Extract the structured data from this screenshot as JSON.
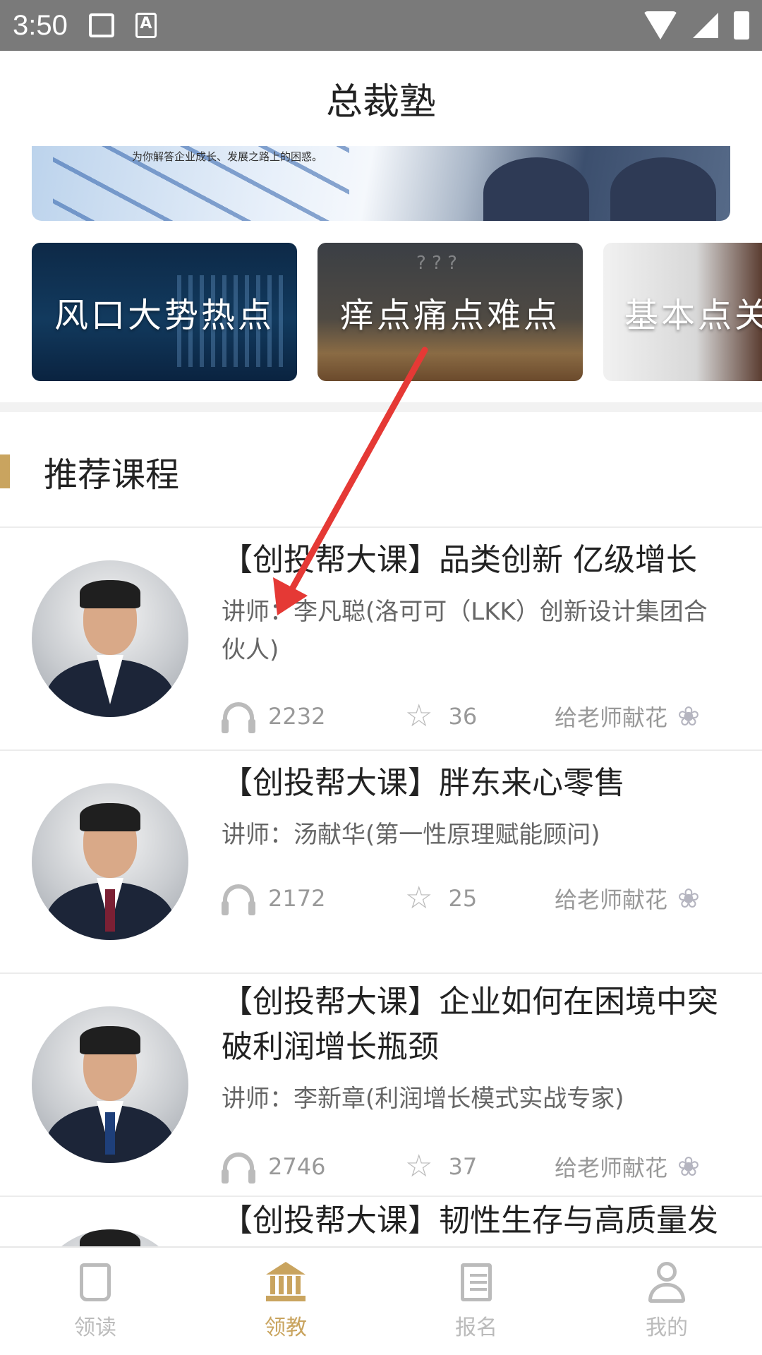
{
  "status_bar": {
    "time": "3:50",
    "icon_a": "A"
  },
  "header": {
    "title": "总裁塾"
  },
  "banner": {
    "text": "为你解答企业成长、发展之路上的困惑。"
  },
  "categories": [
    {
      "label": "风口大势热点"
    },
    {
      "label": "痒点痛点难点"
    },
    {
      "label": "基本点关"
    }
  ],
  "section": {
    "title": "推荐课程"
  },
  "courses": [
    {
      "title": "【创投帮大课】品类创新 亿级增长",
      "teacher": "讲师：李凡聪(洛可可（LKK）创新设计集团合伙人)",
      "listens": "2232",
      "stars": "36",
      "flower_label": "给老师献花"
    },
    {
      "title": "【创投帮大课】胖东来心零售",
      "teacher": "讲师：汤献华(第一性原理赋能顾问)",
      "listens": "2172",
      "stars": "25",
      "flower_label": "给老师献花"
    },
    {
      "title": "【创投帮大课】企业如何在困境中突破利润增长瓶颈",
      "teacher": "讲师：李新章(利润增长模式实战专家)",
      "listens": "2746",
      "stars": "37",
      "flower_label": "给老师献花"
    },
    {
      "title": "【创投帮大课】韧性生存与高质量发"
    }
  ],
  "bottom_nav": [
    {
      "label": "领读",
      "icon": "book-icon",
      "active": false
    },
    {
      "label": "领教",
      "icon": "temple-icon",
      "active": true
    },
    {
      "label": "报名",
      "icon": "form-icon",
      "active": false
    },
    {
      "label": "我的",
      "icon": "user-icon",
      "active": false
    }
  ],
  "colors": {
    "accent": "#c9a45f",
    "status_bar": "#7a7a7a",
    "arrow": "#e53935"
  }
}
